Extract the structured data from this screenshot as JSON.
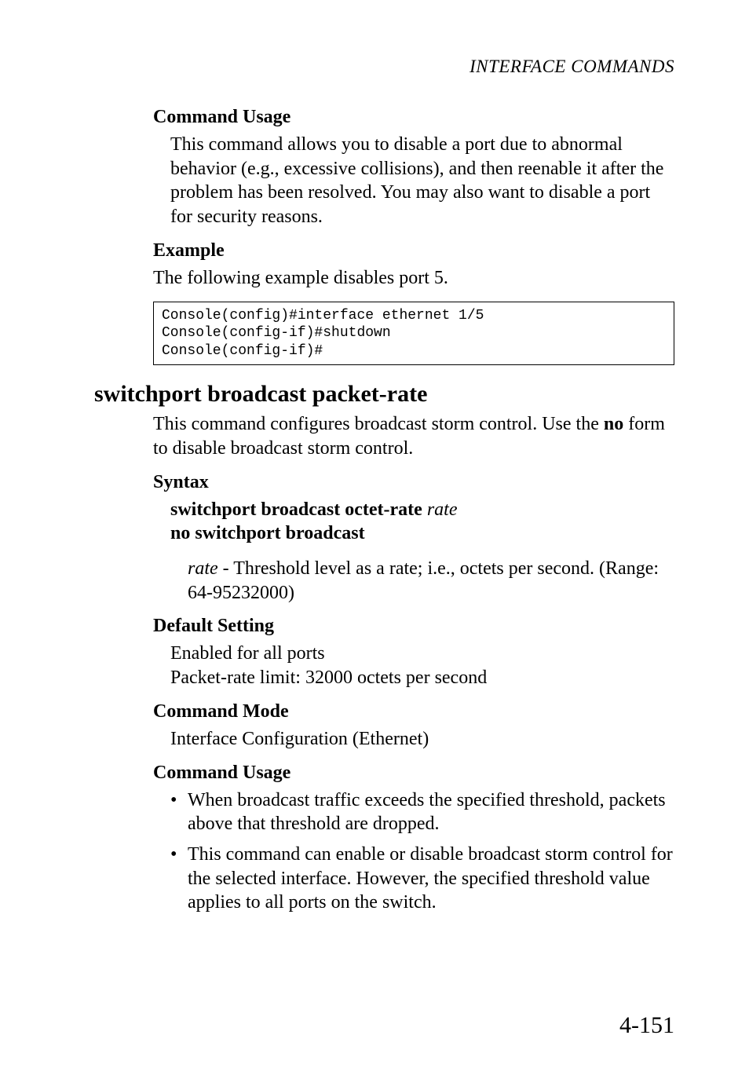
{
  "running_head": "INTERFACE COMMANDS",
  "section1": {
    "command_usage_label": "Command Usage",
    "command_usage_text": "This command allows you to disable a port due to abnormal behavior (e.g., excessive collisions), and then reenable it after the problem has been resolved. You may also want to disable a port for security reasons.",
    "example_label": "Example",
    "example_intro": "The following example disables port 5.",
    "code": "Console(config)#interface ethernet 1/5\nConsole(config-if)#shutdown\nConsole(config-if)#"
  },
  "section2": {
    "title": "switchport broadcast packet-rate",
    "intro_part1": "This command configures broadcast storm control. Use the ",
    "intro_bold": "no",
    "intro_part2": " form to disable broadcast storm control.",
    "syntax_label": "Syntax",
    "syntax_line1_bold": "switchport broadcast octet-rate",
    "syntax_line1_ital": "rate",
    "syntax_line2_bold": "no switchport broadcast",
    "param_ital": "rate",
    "param_text": " - Threshold level as a rate; i.e., octets per second. (Range: 64-95232000)",
    "default_label": "Default Setting",
    "default_line1": "Enabled for all ports",
    "default_line2": "Packet-rate limit: 32000 octets per second",
    "mode_label": "Command Mode",
    "mode_text": "Interface Configuration (Ethernet)",
    "usage_label": "Command Usage",
    "bullets": [
      "When broadcast traffic exceeds the specified threshold, packets above that threshold are dropped.",
      "This command can enable or disable broadcast storm control for the selected interface. However, the specified threshold value applies to all ports on the switch."
    ]
  },
  "page_number": "4-151"
}
